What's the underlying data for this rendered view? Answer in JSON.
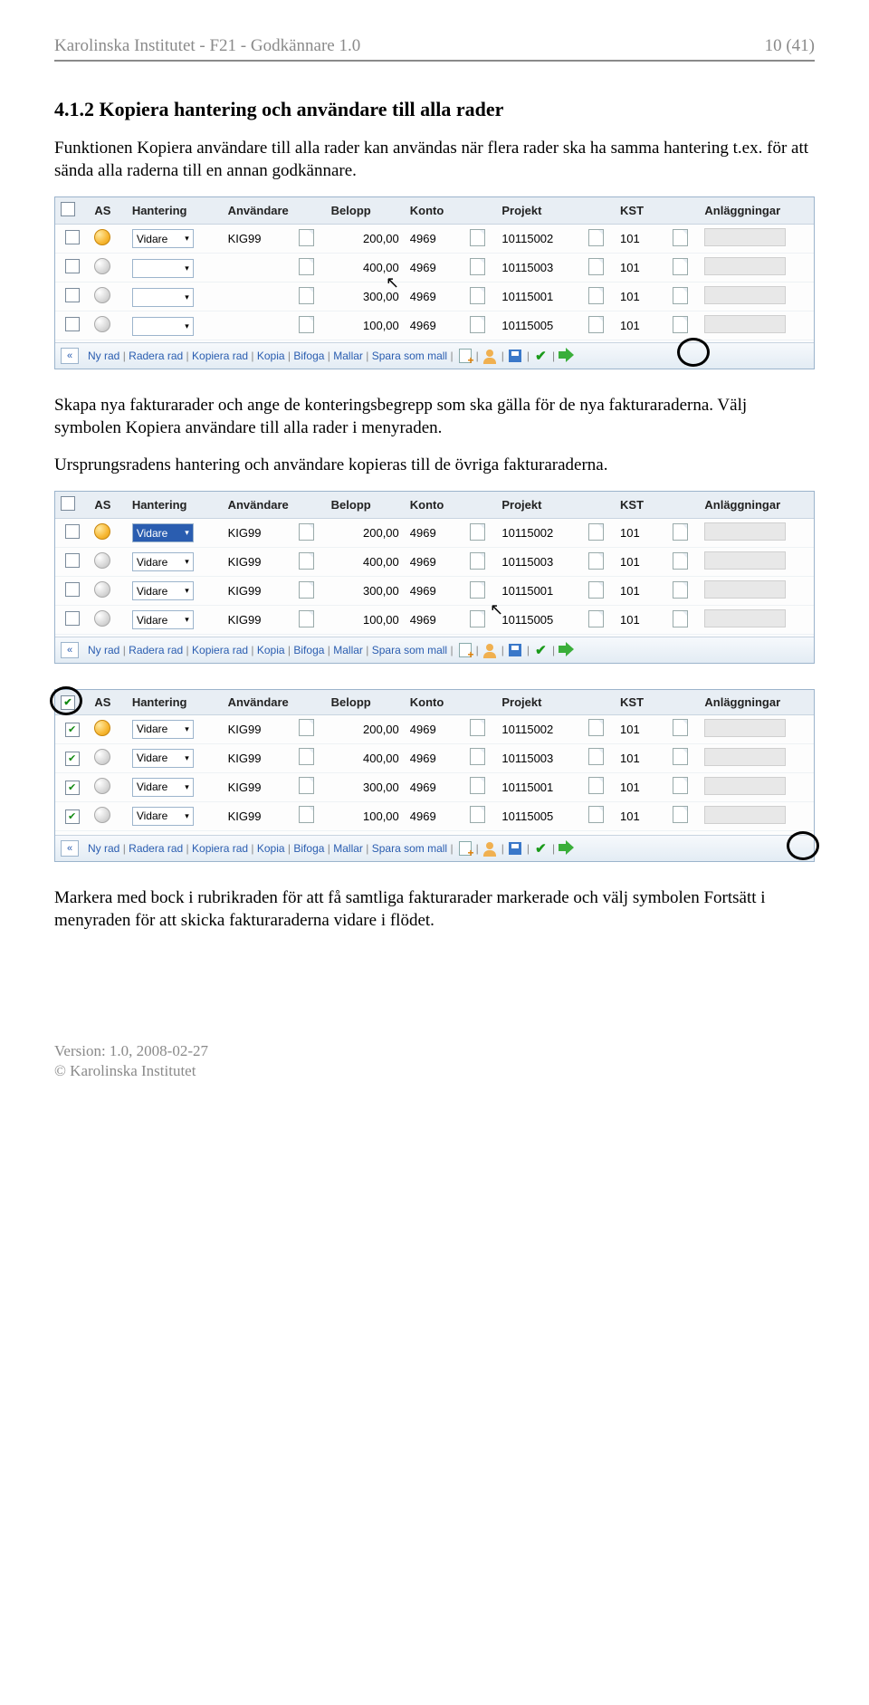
{
  "header": {
    "left": "Karolinska Institutet - F21 - Godkännare 1.0",
    "right": "10 (41)"
  },
  "section": {
    "number": "4.1.2",
    "title": "Kopiera hantering och användare till alla rader"
  },
  "para1": "Funktionen Kopiera användare till alla rader kan användas när flera rader ska ha samma hantering t.ex. för att sända alla raderna till en annan godkännare.",
  "para2": "Skapa nya fakturarader och ange de konteringsbegrepp som ska gälla för de nya fakturaraderna. Välj symbolen Kopiera användare till alla rader i menyraden.",
  "para3": "Ursprungsradens hantering och användare kopieras till de övriga fakturaraderna.",
  "para4": "Markera med bock i rubrikraden för att få samtliga fakturarader markerade och välj symbolen Fortsätt i menyraden för att skicka fakturaraderna vidare i flödet.",
  "columns": {
    "as": "AS",
    "hantering": "Hantering",
    "anvandare": "Användare",
    "belopp": "Belopp",
    "konto": "Konto",
    "projekt": "Projekt",
    "kst": "KST",
    "anlaggningar": "Anläggningar"
  },
  "table1": {
    "rows": [
      {
        "checked": false,
        "status": "orange",
        "hantering": "Vidare",
        "anv": "KIG99",
        "belopp": "200,00",
        "konto": "4969",
        "projekt": "10115002",
        "kst": "101"
      },
      {
        "checked": false,
        "status": "grey",
        "hantering": "",
        "anv": "",
        "belopp": "400,00",
        "konto": "4969",
        "projekt": "10115003",
        "kst": "101"
      },
      {
        "checked": false,
        "status": "grey",
        "hantering": "",
        "anv": "",
        "belopp": "300,00",
        "konto": "4969",
        "projekt": "10115001",
        "kst": "101"
      },
      {
        "checked": false,
        "status": "grey",
        "hantering": "",
        "anv": "",
        "belopp": "100,00",
        "konto": "4969",
        "projekt": "10115005",
        "kst": "101"
      }
    ]
  },
  "table2": {
    "rows": [
      {
        "checked": false,
        "status": "orange",
        "hantering": "Vidare",
        "selected": true,
        "anv": "KIG99",
        "belopp": "200,00",
        "konto": "4969",
        "projekt": "10115002",
        "kst": "101"
      },
      {
        "checked": false,
        "status": "grey",
        "hantering": "Vidare",
        "selected": false,
        "anv": "KIG99",
        "belopp": "400,00",
        "konto": "4969",
        "projekt": "10115003",
        "kst": "101"
      },
      {
        "checked": false,
        "status": "grey",
        "hantering": "Vidare",
        "selected": false,
        "anv": "KIG99",
        "belopp": "300,00",
        "konto": "4969",
        "projekt": "10115001",
        "kst": "101"
      },
      {
        "checked": false,
        "status": "grey",
        "hantering": "Vidare",
        "selected": false,
        "anv": "KIG99",
        "belopp": "100,00",
        "konto": "4969",
        "projekt": "10115005",
        "kst": "101"
      }
    ]
  },
  "table3": {
    "headerChecked": true,
    "rows": [
      {
        "checked": true,
        "status": "orange",
        "hantering": "Vidare",
        "anv": "KIG99",
        "belopp": "200,00",
        "konto": "4969",
        "projekt": "10115002",
        "kst": "101"
      },
      {
        "checked": true,
        "status": "grey",
        "hantering": "Vidare",
        "anv": "KIG99",
        "belopp": "400,00",
        "konto": "4969",
        "projekt": "10115003",
        "kst": "101"
      },
      {
        "checked": true,
        "status": "grey",
        "hantering": "Vidare",
        "anv": "KIG99",
        "belopp": "300,00",
        "konto": "4969",
        "projekt": "10115001",
        "kst": "101"
      },
      {
        "checked": true,
        "status": "grey",
        "hantering": "Vidare",
        "anv": "KIG99",
        "belopp": "100,00",
        "konto": "4969",
        "projekt": "10115005",
        "kst": "101"
      }
    ]
  },
  "menubar": {
    "items": [
      "Ny rad",
      "Radera rad",
      "Kopiera rad",
      "Kopia",
      "Bifoga",
      "Mallar",
      "Spara som mall"
    ]
  },
  "footer": {
    "version": "Version: 1.0, 2008-02-27",
    "copyright": "© Karolinska Institutet"
  }
}
